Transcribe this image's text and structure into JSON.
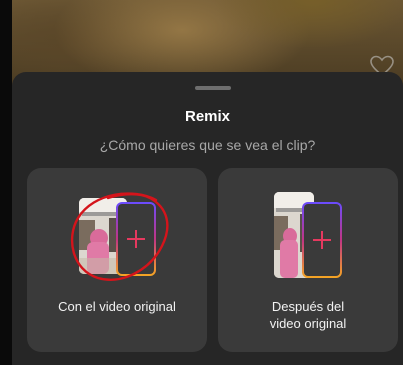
{
  "sheet": {
    "title": "Remix",
    "subtitle": "¿Cómo quieres que se vea el clip?"
  },
  "options": [
    {
      "label": "Con el video original",
      "icon": "side-by-side-layout-icon"
    },
    {
      "label_line1": "Después del",
      "label_line2": "video original",
      "icon": "after-original-layout-icon"
    }
  ],
  "colors": {
    "sheet_background": "#262626",
    "card_background": "#3a3a3a",
    "accent_plus": "#e6395f",
    "annotation_circle": "#d4141b"
  }
}
